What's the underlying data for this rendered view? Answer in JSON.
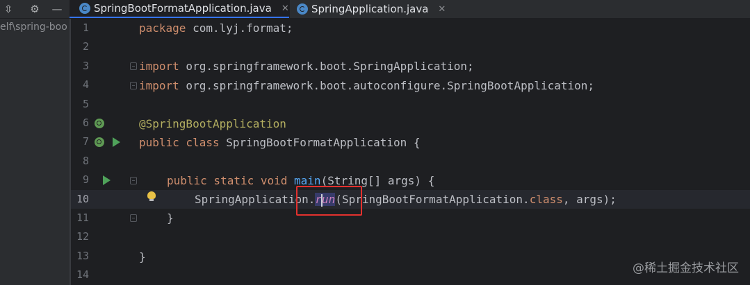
{
  "toolbar": {
    "collapse_icon": "collapse-icon",
    "settings_icon": "gear-icon",
    "hide_icon": "minimize-icon"
  },
  "tabs": [
    {
      "label": "SpringBootFormatApplication.java",
      "active": true,
      "icon": "java-class-icon"
    },
    {
      "label": "SpringApplication.java",
      "active": false,
      "icon": "java-class-icon"
    }
  ],
  "project_panel": {
    "path_fragment": "elf\\spring-boo"
  },
  "editor": {
    "current_line": 10,
    "line_numbers": [
      "1",
      "2",
      "3",
      "4",
      "5",
      "6",
      "7",
      "8",
      "9",
      "10",
      "11",
      "12",
      "13",
      "14"
    ],
    "lines": {
      "l1_kw": "package",
      "l1_pkg": " com.lyj.format;",
      "l3_kw": "import",
      "l3_pkg": " org.springframework.boot.",
      "l3_cls": "SpringApplication",
      "l3_end": ";",
      "l4_kw": "import",
      "l4_pkg": " org.springframework.boot.autoconfigure.",
      "l4_cls": "SpringBootApplication",
      "l4_end": ";",
      "l6_ann": "@SpringBootApplication",
      "l7_kw": "public class",
      "l7_cls": " SpringBootFormatApplication",
      "l7_end": " {",
      "l9_kw": "public static void",
      "l9_fn": " main",
      "l9_rest1": "(String[] args) {",
      "l10_cls": "SpringApplication",
      "l10_dot": ".",
      "l10_r": "r",
      "l10_un": "un",
      "l10_open": "(",
      "l10_arg": "SpringBootFormatApplication",
      "l10_dot2": ".",
      "l10_kw": "class",
      "l10_end": ", args);",
      "l11": "}",
      "l13": "}"
    }
  },
  "watermark": "@稀土掘金技术社区",
  "colors": {
    "highlight_box": "#e3312e",
    "keyword": "#cf8e6d",
    "annotation": "#b3ae60",
    "method": "#56a8f5"
  }
}
